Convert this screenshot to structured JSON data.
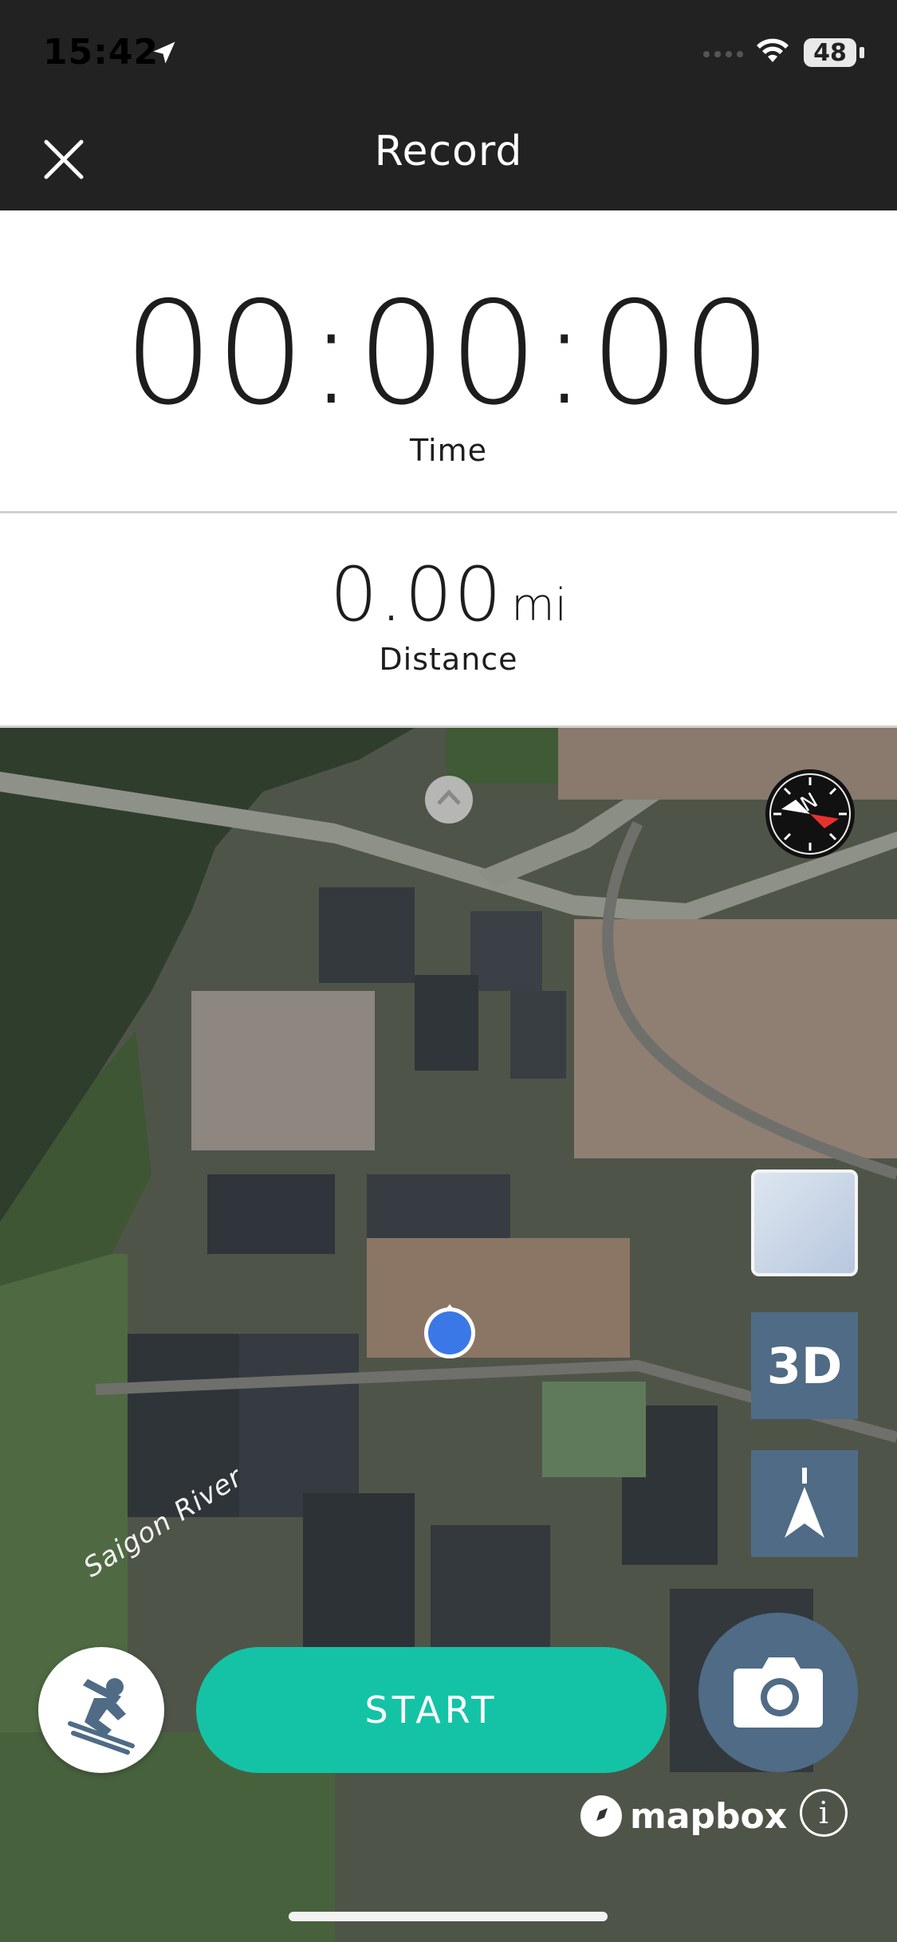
{
  "status_bar": {
    "time": "15:42",
    "battery_level": "48",
    "icons": [
      "location-arrow-icon",
      "signal-icon",
      "wifi-icon",
      "battery-icon"
    ]
  },
  "nav": {
    "title": "Record",
    "close_icon": "close-icon"
  },
  "stats": {
    "time_value": "00:00:00",
    "time_label": "Time",
    "distance_value": "0.00",
    "distance_unit": "mi",
    "distance_label": "Distance"
  },
  "map": {
    "river_label": "Saigon River",
    "compass_letter": "N",
    "toggle_3d_label": "3D",
    "attribution_brand": "mapbox",
    "info_label": "i"
  },
  "controls": {
    "start_label": "START",
    "activity_icon": "skiing-icon",
    "camera_icon": "camera-icon"
  },
  "colors": {
    "header_bg": "#222222",
    "start_button": "#14c3a5",
    "map_button": "#4f6b86",
    "location_dot": "#3a78e8"
  }
}
